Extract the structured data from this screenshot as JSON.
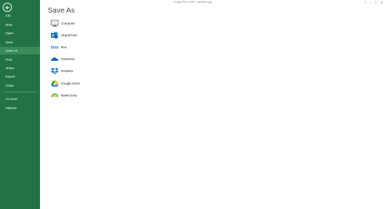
{
  "window": {
    "title": "Project Plan 2013 - sample.mpp",
    "controls": [
      "?",
      "–",
      "▢",
      "✕"
    ]
  },
  "sidebar": {
    "items": [
      {
        "label": "Info",
        "selected": false
      },
      {
        "label": "New",
        "selected": false
      },
      {
        "label": "Open",
        "selected": false
      },
      {
        "label": "Save",
        "selected": false
      },
      {
        "label": "Save As",
        "selected": true
      },
      {
        "label": "Print",
        "selected": false
      },
      {
        "label": "Share",
        "selected": false
      },
      {
        "label": "Export",
        "selected": false
      },
      {
        "label": "Close",
        "selected": false
      },
      {
        "label": "Account",
        "selected": false
      },
      {
        "label": "Options",
        "selected": false
      }
    ]
  },
  "main": {
    "title": "Save As",
    "places": [
      {
        "label": "Computer",
        "icon": "computer-icon"
      },
      {
        "label": "SharePoint",
        "icon": "sharepoint-icon"
      },
      {
        "label": "Box",
        "icon": "box-icon"
      },
      {
        "label": "OneDrive",
        "icon": "onedrive-icon"
      },
      {
        "label": "Dropbox",
        "icon": "dropbox-icon"
      },
      {
        "label": "Google Drive",
        "icon": "google-drive-icon"
      },
      {
        "label": "BaseCamp",
        "icon": "basecamp-icon"
      }
    ]
  },
  "colors": {
    "sidebar": "#217346",
    "sidebar_selected": "#3a8a5a"
  }
}
